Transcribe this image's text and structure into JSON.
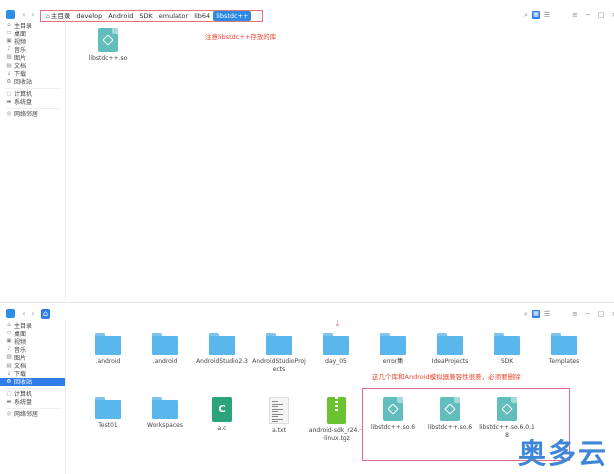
{
  "top_window": {
    "nav": {
      "back": "‹",
      "forward": "›"
    },
    "breadcrumb": [
      {
        "label": "主目录",
        "icon": "home-icon"
      },
      {
        "label": "develop"
      },
      {
        "label": "Android"
      },
      {
        "label": "SDK"
      },
      {
        "label": "emulator"
      },
      {
        "label": "lib64"
      },
      {
        "label": "libstdc++",
        "current": true
      }
    ],
    "toolbar": {
      "search": "⌕",
      "grid_view": "▦",
      "list_view": "☰"
    },
    "window_controls": {
      "menu": "≡",
      "minimize": "−",
      "maximize": "□",
      "close": "×"
    },
    "sidebar": [
      {
        "label": "主目录",
        "icon": "home-icon"
      },
      {
        "label": "桌面",
        "icon": "desktop-icon"
      },
      {
        "label": "视频",
        "icon": "video-icon"
      },
      {
        "label": "音乐",
        "icon": "music-icon"
      },
      {
        "label": "图片",
        "icon": "picture-icon"
      },
      {
        "label": "文档",
        "icon": "document-icon"
      },
      {
        "label": "下载",
        "icon": "download-icon"
      },
      {
        "label": "回收站",
        "icon": "trash-icon"
      },
      {
        "sep": true
      },
      {
        "label": "计算机",
        "icon": "computer-icon"
      },
      {
        "label": "系统盘",
        "icon": "disk-icon"
      },
      {
        "sep": true
      },
      {
        "label": "网络邻居",
        "icon": "network-icon"
      }
    ],
    "files": [
      {
        "label": "libstdc++.so",
        "type": "so"
      }
    ],
    "annotation": "注意libstdc++存放的库"
  },
  "bottom_window": {
    "sidebar": [
      {
        "label": "主目录",
        "icon": "home-icon"
      },
      {
        "label": "桌面",
        "icon": "desktop-icon"
      },
      {
        "label": "视频",
        "icon": "video-icon"
      },
      {
        "label": "音乐",
        "icon": "music-icon"
      },
      {
        "label": "图片",
        "icon": "picture-icon"
      },
      {
        "label": "文档",
        "icon": "document-icon"
      },
      {
        "label": "下载",
        "icon": "download-icon"
      },
      {
        "label": "回收站",
        "icon": "trash-icon",
        "active": true
      },
      {
        "sep": true
      },
      {
        "label": "计算机",
        "icon": "computer-icon"
      },
      {
        "label": "系统盘",
        "icon": "disk-icon"
      },
      {
        "sep": true
      },
      {
        "label": "网络邻居",
        "icon": "network-icon"
      }
    ],
    "files": [
      {
        "label": ".android",
        "type": "folder"
      },
      {
        "label": ".android",
        "type": "folder"
      },
      {
        "label": "AndroidStudio2.3",
        "type": "folder"
      },
      {
        "label": "AndroidStudioProjects",
        "type": "folder"
      },
      {
        "label": "day_05",
        "type": "folder"
      },
      {
        "label": "error集",
        "type": "folder"
      },
      {
        "label": "IdeaProjects",
        "type": "folder"
      },
      {
        "label": "SDK",
        "type": "folder"
      },
      {
        "label": "Templates",
        "type": "folder"
      },
      {
        "label": "Test01",
        "type": "folder"
      },
      {
        "label": "Workspaces",
        "type": "folder"
      },
      {
        "label": "a.c",
        "type": "c"
      },
      {
        "label": "a.txt",
        "type": "txt"
      },
      {
        "label": "android-sdk_r24.···linux.tgz",
        "type": "tgz"
      },
      {
        "label": "libstdc++.so.6",
        "type": "so"
      },
      {
        "label": "libstdc++.so.6",
        "type": "so"
      },
      {
        "label": "libstdc++.so.6.0.18",
        "type": "so"
      }
    ],
    "annotation": "这几个库和Android模拟器兼容性很差，必须要删除",
    "drag_marker": "⇣"
  },
  "watermark": "奥多云",
  "colors": {
    "accent": "#2e7de9",
    "annotation": "#e8452d",
    "highlight_box": "#e06a8a"
  }
}
